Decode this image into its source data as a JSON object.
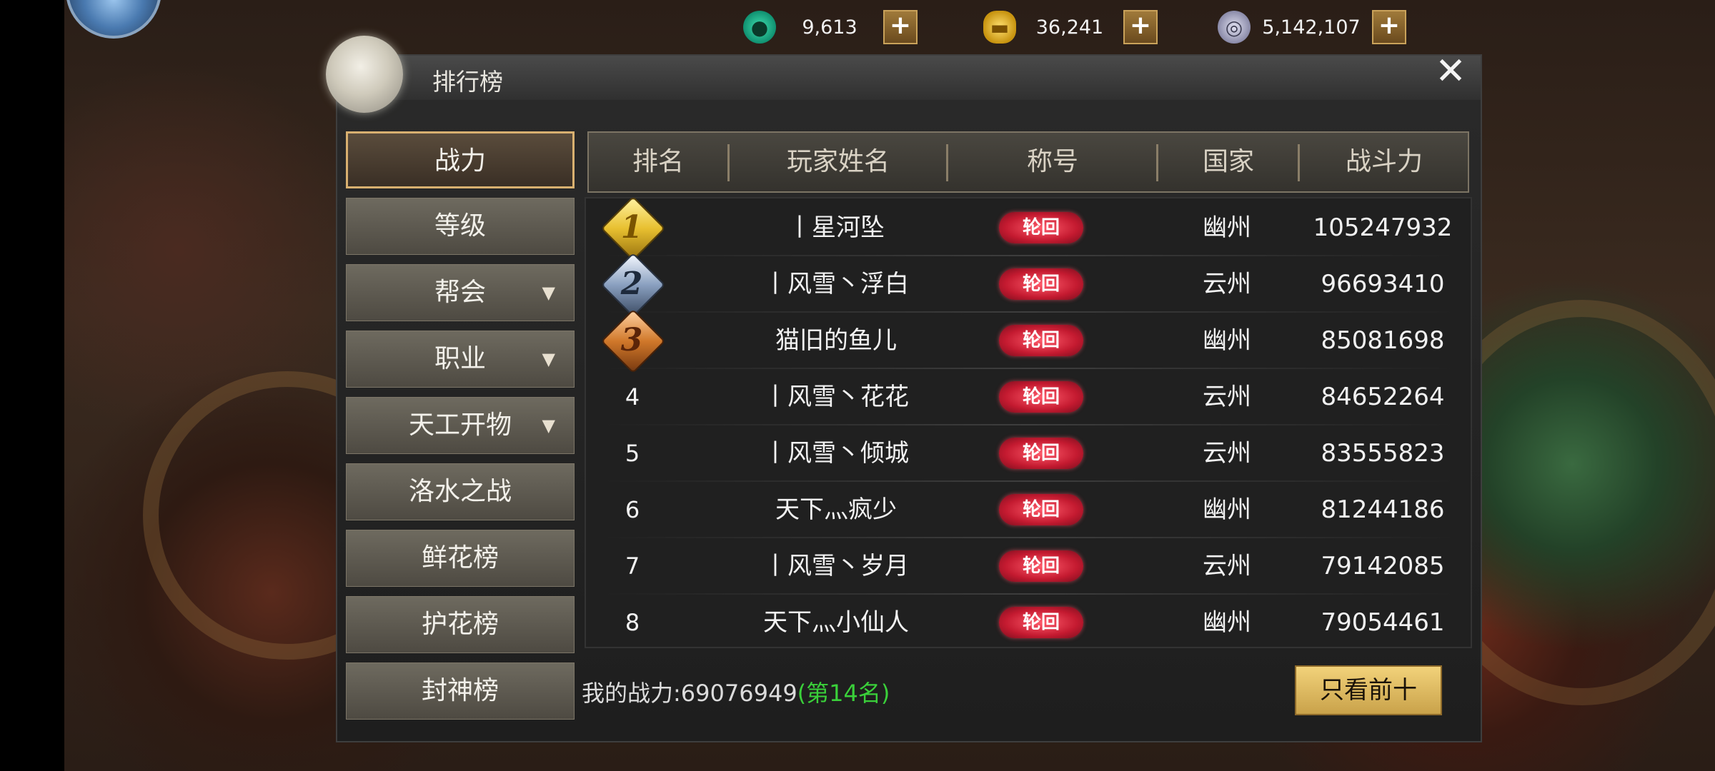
{
  "currencies": {
    "jade": {
      "icon": "jade-icon",
      "value": "9,613"
    },
    "gold": {
      "icon": "gold-ingot-icon",
      "value": "36,241"
    },
    "silver": {
      "icon": "silver-coin-icon",
      "value": "5,142,107"
    },
    "plus_label": "+"
  },
  "panel": {
    "title": "排行榜",
    "close_label": "✕"
  },
  "tabs": [
    {
      "label": "战力",
      "active": true
    },
    {
      "label": "等级"
    },
    {
      "label": "帮会",
      "dropdown": "▼"
    },
    {
      "label": "职业",
      "dropdown": "▼"
    },
    {
      "label": "天工开物",
      "dropdown": "▼"
    },
    {
      "label": "洛水之战"
    },
    {
      "label": "鲜花榜"
    },
    {
      "label": "护花榜"
    },
    {
      "label": "封神榜"
    }
  ],
  "table": {
    "headers": [
      "排名",
      "玩家姓名",
      "称号",
      "国家",
      "战斗力"
    ],
    "title_badge": "轮回",
    "rows": [
      {
        "rank": "1",
        "name": "丨星河坠",
        "country": "幽州",
        "power": "105247932"
      },
      {
        "rank": "2",
        "name": "丨风雪丶浮白",
        "country": "云州",
        "power": "96693410"
      },
      {
        "rank": "3",
        "name": "猫旧的鱼儿",
        "country": "幽州",
        "power": "85081698"
      },
      {
        "rank": "4",
        "name": "丨风雪丶花花",
        "country": "云州",
        "power": "84652264"
      },
      {
        "rank": "5",
        "name": "丨风雪丶倾城",
        "country": "云州",
        "power": "83555823"
      },
      {
        "rank": "6",
        "name": "天下灬疯少",
        "country": "幽州",
        "power": "81244186"
      },
      {
        "rank": "7",
        "name": "丨风雪丶岁月",
        "country": "云州",
        "power": "79142085"
      },
      {
        "rank": "8",
        "name": "天下灬小仙人",
        "country": "幽州",
        "power": "79054461"
      }
    ]
  },
  "footer": {
    "my_power_label": "我的战力:",
    "my_power_value": "69076949",
    "my_rank": "(第14名)",
    "top10_button": "只看前十"
  },
  "colors": {
    "gold_medal": "#e8c030",
    "silver_medal": "#8aa0c0",
    "bronze_medal": "#d0782a",
    "rank_text_green": "#3ad03a",
    "accent_gold": "#d8b070"
  }
}
